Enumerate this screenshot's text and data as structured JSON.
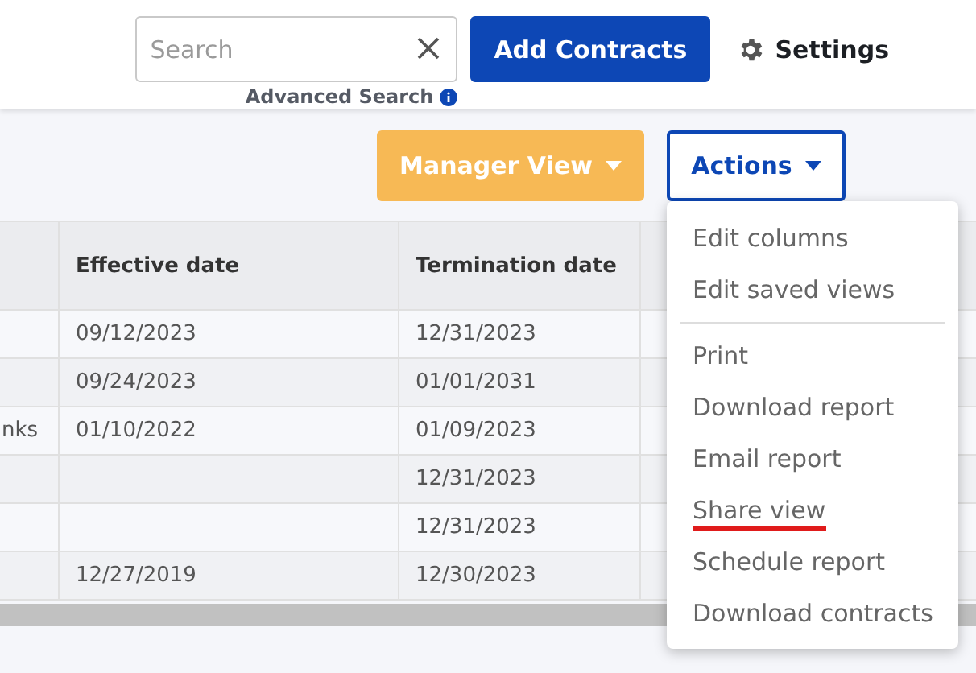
{
  "header": {
    "search": {
      "placeholder": "Search"
    },
    "advanced_search": "Advanced Search",
    "add_button": "Add Contracts",
    "settings": "Settings"
  },
  "toolbar": {
    "view_button": "Manager View",
    "actions_button": "Actions"
  },
  "table": {
    "columns": [
      "",
      "Effective date",
      "Termination date",
      ""
    ],
    "rows": [
      [
        "",
        "09/12/2023",
        "12/31/2023",
        ""
      ],
      [
        "",
        "09/24/2023",
        "01/01/2031",
        ""
      ],
      [
        "nks",
        "01/10/2022",
        "01/09/2023",
        ""
      ],
      [
        "",
        "",
        "12/31/2023",
        ""
      ],
      [
        "",
        "",
        "12/31/2023",
        ""
      ],
      [
        "",
        "12/27/2019",
        "12/30/2023",
        ""
      ]
    ]
  },
  "actions_menu": {
    "groups": [
      [
        {
          "label": "Edit columns",
          "underlined": false
        },
        {
          "label": "Edit saved views",
          "underlined": false
        }
      ],
      [
        {
          "label": "Print",
          "underlined": false
        },
        {
          "label": "Download report",
          "underlined": false
        },
        {
          "label": "Email report",
          "underlined": false
        },
        {
          "label": "Share view",
          "underlined": true
        },
        {
          "label": "Schedule report",
          "underlined": false
        },
        {
          "label": "Download contracts",
          "underlined": false
        }
      ]
    ]
  }
}
